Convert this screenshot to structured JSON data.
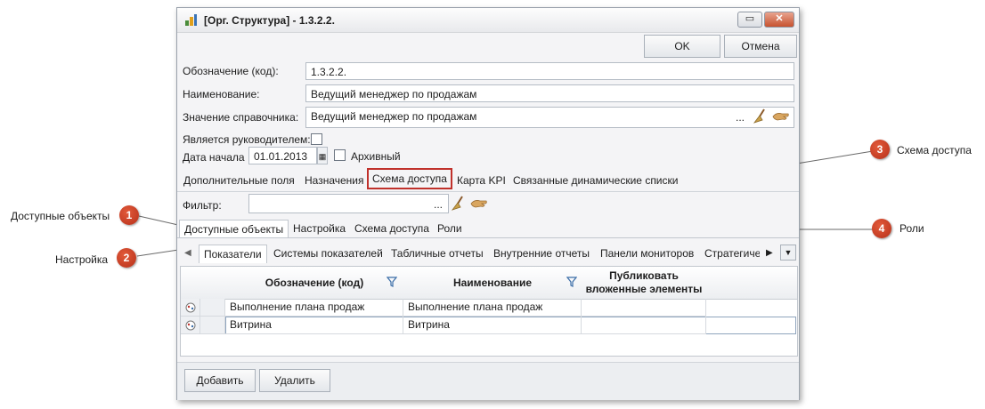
{
  "window": {
    "title": "[Орг. Структура] - 1.3.2.2.",
    "ok_label": "OK",
    "cancel_label": "Отмена"
  },
  "form": {
    "code_label": "Обозначение (код):",
    "code_value": "1.3.2.2.",
    "name_label": "Наименование:",
    "name_value": "Ведущий менеджер по продажам",
    "ref_label": "Значение справочника:",
    "ref_value": "Ведущий менеджер по продажам",
    "ref_dots": "...",
    "is_head_label": "Является руководителем:",
    "is_head_checked": false,
    "start_label": "Дата начала",
    "start_value": "01.01.2013",
    "archive_label": "Архивный",
    "archive_checked": false
  },
  "tabs": [
    "Дополнительные поля",
    "Назначения",
    "Схема доступа",
    "Карта KPI",
    "Связанные динамические списки"
  ],
  "selected_tab": "Схема доступа",
  "filter": {
    "label": "Фильтр:",
    "value": "",
    "dots": "..."
  },
  "subtabs": [
    "Доступные объекты",
    "Настройка",
    "Схема доступа",
    "Роли"
  ],
  "grid_tabs": [
    "Показатели",
    "Системы показателей",
    "Табличные отчеты",
    "Внутренние отчеты",
    "Панели мониторов",
    "Стратегиче"
  ],
  "grid": {
    "columns": [
      "Обозначение (код)",
      "Наименование",
      "Публиковать вложенные элементы"
    ],
    "rows": [
      [
        "Выполнение плана продаж",
        "Выполнение плана продаж",
        ""
      ],
      [
        "Витрина",
        "Витрина",
        ""
      ]
    ]
  },
  "footer": {
    "add_label": "Добавить",
    "delete_label": "Удалить"
  },
  "callouts": [
    {
      "num": "1",
      "label": "Доступные объекты"
    },
    {
      "num": "2",
      "label": "Настройка"
    },
    {
      "num": "3",
      "label": "Схема доступа"
    },
    {
      "num": "4",
      "label": "Роли"
    }
  ],
  "colors": {
    "accent": "#c0312b",
    "callout": "#c8401f",
    "border": "#b5bcc5"
  }
}
